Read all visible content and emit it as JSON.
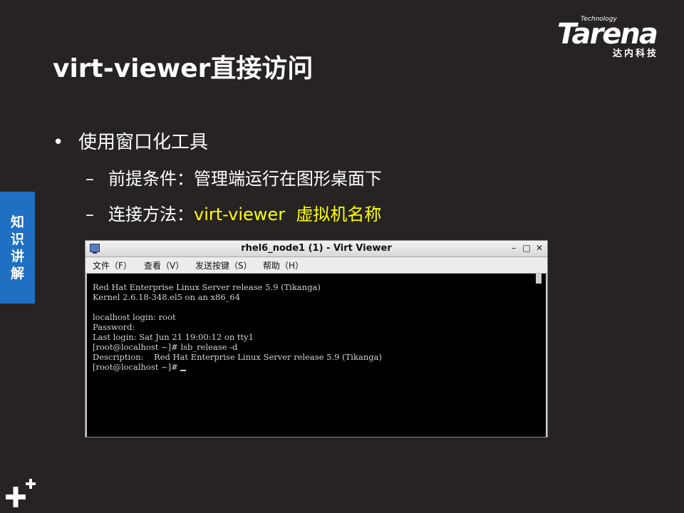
{
  "logo": {
    "tech": "Technology",
    "brand": "Tarena",
    "sub": "达内科技"
  },
  "slide": {
    "title": "virt-viewer直接访问",
    "bullet": "使用窗口化工具",
    "sub1": "前提条件：管理端运行在图形桌面下",
    "sub2_prefix": "连接方法：",
    "sub2_highlight": "virt-viewer  虚拟机名称",
    "side_tab": [
      "知",
      "识",
      "讲",
      "解"
    ]
  },
  "window": {
    "title": "rhel6_node1 (1) - Virt Viewer",
    "buttons": {
      "minimize": "–",
      "maximize": "□",
      "close": "✕"
    },
    "menu": [
      "文件（F）",
      "查看（V）",
      "发送按键（S）",
      "帮助（H）"
    ]
  },
  "console": {
    "lines": [
      "Red Hat Enterprise Linux Server release 5.9 (Tikanga)",
      "Kernel 2.6.18-348.el5 on an x86_64",
      "",
      "localhost login: root",
      "Password:",
      "Last login: Sat Jun 21 19:00:12 on tty1",
      "[root@localhost ~]# lsb_release -d",
      "Description:    Red Hat Enterprise Linux Server release 5.9 (Tikanga)",
      "[root@localhost ~]# "
    ]
  },
  "icons": {
    "app": "virt-viewer-app-icon",
    "plus": "plus-logo-icon"
  },
  "colors": {
    "background": "#262322",
    "highlight": "#ffff00",
    "side_tab": "#1f6fc2",
    "console_bg": "#000000"
  }
}
